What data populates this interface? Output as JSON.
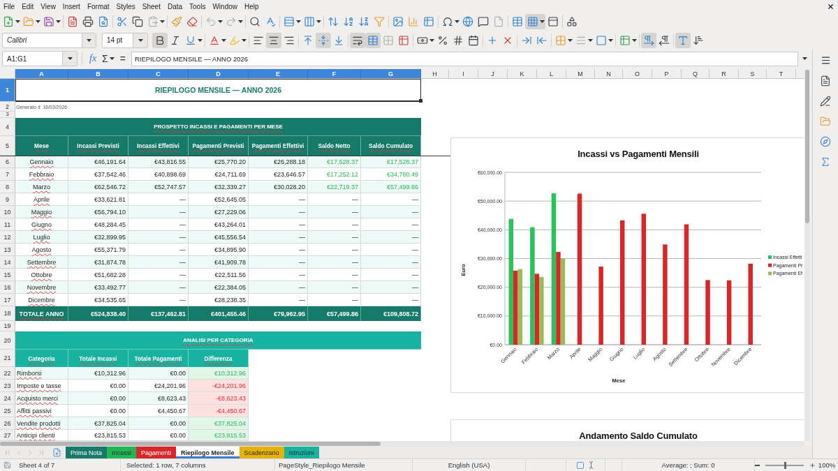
{
  "menu": [
    "File",
    "Edit",
    "View",
    "Insert",
    "Format",
    "Styles",
    "Sheet",
    "Data",
    "Tools",
    "Window",
    "Help"
  ],
  "standard_toolbar": [
    {
      "buttons": [
        {
          "kind": "new",
          "pressed": false,
          "disabled": false
        },
        {
          "kind": "open",
          "pressed": false,
          "disabled": false
        },
        {
          "kind": "save",
          "pressed": false,
          "disabled": false
        }
      ]
    },
    {
      "buttons": [
        {
          "kind": "pdf",
          "pressed": false,
          "disabled": false
        },
        {
          "kind": "print",
          "pressed": false,
          "disabled": false
        },
        {
          "kind": "preview",
          "pressed": false,
          "disabled": false
        }
      ]
    },
    {
      "buttons": [
        {
          "kind": "cut",
          "pressed": false,
          "disabled": false
        },
        {
          "kind": "copy",
          "pressed": false,
          "disabled": false
        },
        {
          "kind": "paste",
          "pressed": false,
          "disabled": true
        }
      ]
    },
    {
      "buttons": [
        {
          "kind": "clone",
          "pressed": false,
          "disabled": false
        },
        {
          "kind": "clear",
          "pressed": false,
          "disabled": false
        }
      ]
    },
    {
      "buttons": [
        {
          "kind": "undo",
          "pressed": false,
          "disabled": true
        },
        {
          "kind": "redo",
          "pressed": false,
          "disabled": true
        }
      ]
    },
    {
      "buttons": [
        {
          "kind": "find",
          "pressed": false,
          "disabled": false
        },
        {
          "kind": "spelling",
          "pressed": false,
          "disabled": false
        }
      ]
    },
    {
      "buttons": [
        {
          "kind": "rows",
          "pressed": false,
          "disabled": false
        },
        {
          "kind": "columns",
          "pressed": false,
          "disabled": false
        }
      ]
    },
    {
      "buttons": [
        {
          "kind": "sort",
          "pressed": false,
          "disabled": false
        },
        {
          "kind": "sortasc",
          "pressed": false,
          "disabled": false
        },
        {
          "kind": "sortdesc",
          "pressed": false,
          "disabled": false
        },
        {
          "kind": "autofilter",
          "pressed": false,
          "disabled": false
        }
      ]
    },
    {
      "buttons": [
        {
          "kind": "image",
          "pressed": false,
          "disabled": false
        },
        {
          "kind": "chart",
          "pressed": false,
          "disabled": false
        },
        {
          "kind": "pivot",
          "pressed": false,
          "disabled": false
        }
      ]
    },
    {
      "buttons": [
        {
          "kind": "special",
          "pressed": false,
          "disabled": false
        },
        {
          "kind": "hyperlink",
          "pressed": false,
          "disabled": false
        },
        {
          "kind": "comment",
          "pressed": false,
          "disabled": false
        },
        {
          "kind": "headerfooter",
          "pressed": false,
          "disabled": true
        }
      ]
    },
    {
      "buttons": [
        {
          "kind": "printarea",
          "pressed": false,
          "disabled": false
        },
        {
          "kind": "freeze",
          "pressed": true,
          "disabled": false
        },
        {
          "kind": "split",
          "pressed": false,
          "disabled": false
        }
      ]
    },
    {
      "buttons": [
        {
          "kind": "draw",
          "pressed": false,
          "disabled": false
        }
      ]
    }
  ],
  "formatting_toolbar": {
    "font_name": "Calibri",
    "font_size": "14 pt",
    "groups": [
      {
        "buttons": [
          {
            "kind": "bold",
            "pressed": true,
            "disabled": false
          },
          {
            "kind": "italic",
            "pressed": false,
            "disabled": false
          },
          {
            "kind": "underline",
            "pressed": false,
            "disabled": false
          }
        ]
      },
      {
        "buttons": [
          {
            "kind": "fontcolor",
            "pressed": false,
            "disabled": false
          },
          {
            "kind": "highlight",
            "pressed": false,
            "disabled": false
          }
        ]
      },
      {
        "buttons": [
          {
            "kind": "left",
            "pressed": false,
            "disabled": false
          },
          {
            "kind": "center",
            "pressed": true,
            "disabled": false
          },
          {
            "kind": "right",
            "pressed": false,
            "disabled": false
          }
        ]
      },
      {
        "buttons": [
          {
            "kind": "top",
            "pressed": false,
            "disabled": false
          },
          {
            "kind": "middle",
            "pressed": true,
            "disabled": false
          },
          {
            "kind": "bottom",
            "pressed": false,
            "disabled": false
          }
        ]
      },
      {
        "buttons": [
          {
            "kind": "wrap",
            "pressed": true,
            "disabled": false
          },
          {
            "kind": "mergecenter",
            "pressed": true,
            "disabled": false
          },
          {
            "kind": "merge",
            "pressed": false,
            "disabled": true
          },
          {
            "kind": "unmerge",
            "pressed": false,
            "disabled": false
          }
        ]
      },
      {
        "buttons": [
          {
            "kind": "currency",
            "pressed": false,
            "disabled": false
          },
          {
            "kind": "percent",
            "pressed": false,
            "disabled": false
          },
          {
            "kind": "number",
            "pressed": false,
            "disabled": false
          },
          {
            "kind": "date",
            "pressed": false,
            "disabled": false
          }
        ]
      },
      {
        "buttons": [
          {
            "kind": "adddecimal",
            "pressed": false,
            "disabled": false
          },
          {
            "kind": "deldecimal",
            "pressed": false,
            "disabled": false
          }
        ]
      },
      {
        "buttons": [
          {
            "kind": "indent",
            "pressed": false,
            "disabled": false
          },
          {
            "kind": "outdent",
            "pressed": false,
            "disabled": false
          }
        ]
      },
      {
        "buttons": [
          {
            "kind": "borders",
            "pressed": false,
            "disabled": false
          },
          {
            "kind": "borderstyle",
            "pressed": false,
            "disabled": true
          },
          {
            "kind": "bordercolor",
            "pressed": false,
            "disabled": false
          }
        ]
      },
      {
        "buttons": [
          {
            "kind": "conditional",
            "pressed": false,
            "disabled": false
          }
        ]
      },
      {
        "buttons": [
          {
            "kind": "ltr",
            "pressed": true,
            "disabled": false
          },
          {
            "kind": "rtl",
            "pressed": false,
            "disabled": false
          }
        ]
      },
      {
        "buttons": [
          {
            "kind": "textflow",
            "pressed": true,
            "disabled": false
          },
          {
            "kind": "vertical",
            "pressed": false,
            "disabled": false
          }
        ]
      }
    ]
  },
  "formula_bar": {
    "name_box": "A1:G1",
    "buttons": [
      {
        "kind": "function",
        "label": "fx"
      },
      {
        "kind": "sum",
        "label": "Σ"
      },
      {
        "kind": "formula",
        "label": "="
      }
    ],
    "content": "RIEPILOGO MENSILE — ANNO 2026"
  },
  "sheet": {
    "column_headers": [
      {
        "label": "A",
        "selected": true
      },
      {
        "label": "B",
        "selected": true
      },
      {
        "label": "C",
        "selected": true
      },
      {
        "label": "D",
        "selected": true
      },
      {
        "label": "E",
        "selected": true
      },
      {
        "label": "F",
        "selected": true
      },
      {
        "label": "G",
        "selected": true
      },
      {
        "label": "H",
        "selected": false
      },
      {
        "label": "I",
        "selected": false
      },
      {
        "label": "J",
        "selected": false
      },
      {
        "label": "K",
        "selected": false
      },
      {
        "label": "L",
        "selected": false
      },
      {
        "label": "M",
        "selected": false
      },
      {
        "label": "N",
        "selected": false
      },
      {
        "label": "O",
        "selected": false
      },
      {
        "label": "P",
        "selected": false
      },
      {
        "label": "Q",
        "selected": false
      },
      {
        "label": "R",
        "selected": false
      },
      {
        "label": "S",
        "selected": false
      },
      {
        "label": "T",
        "selected": false
      }
    ],
    "row_headers": [
      {
        "label": "1",
        "selected": true
      },
      {
        "label": "2",
        "selected": false
      },
      {
        "label": "3",
        "selected": false
      },
      {
        "label": "4",
        "selected": false
      },
      {
        "label": "5",
        "selected": false
      },
      {
        "label": "6",
        "selected": false
      },
      {
        "label": "7",
        "selected": false
      },
      {
        "label": "8",
        "selected": false
      },
      {
        "label": "9",
        "selected": false
      },
      {
        "label": "10",
        "selected": false
      },
      {
        "label": "11",
        "selected": false
      },
      {
        "label": "12",
        "selected": false
      },
      {
        "label": "13",
        "selected": false
      },
      {
        "label": "14",
        "selected": false
      },
      {
        "label": "15",
        "selected": false
      },
      {
        "label": "16",
        "selected": false
      },
      {
        "label": "17",
        "selected": false
      },
      {
        "label": "18",
        "selected": false
      },
      {
        "label": "19",
        "selected": false
      },
      {
        "label": "20",
        "selected": false
      },
      {
        "label": "21",
        "selected": false
      },
      {
        "label": "22",
        "selected": false
      },
      {
        "label": "23",
        "selected": false
      },
      {
        "label": "24",
        "selected": false
      },
      {
        "label": "25",
        "selected": false
      },
      {
        "label": "26",
        "selected": false
      },
      {
        "label": "27",
        "selected": false
      }
    ],
    "title": {
      "text": "RIEPILOGO MENSILE — ANNO 2026",
      "selected": true
    },
    "generated": "Generato il: 16/03/2026",
    "monthly_table": {
      "caption": "PROSPETTO INCASSI E PAGAMENTI PER MESE",
      "columns": [
        "Mese",
        "Incassi Previsti",
        "Incassi Effettivi",
        "Pagamenti Previsti",
        "Pagamenti Effettivi",
        "Saldo Netto",
        "Saldo Cumulato"
      ],
      "rows": [
        {
          "kind": "actual",
          "cells": [
            "Gennaio",
            "€46,191.64",
            "€43,816.55",
            "€25,770.20",
            "€26,288.18",
            "€17,528.37",
            "€17,528.37"
          ]
        },
        {
          "kind": "actual",
          "cells": [
            "Febbraio",
            "€37,542.46",
            "€40,898.69",
            "€24,711.69",
            "€23,646.57",
            "€17,252.12",
            "€34,780.49"
          ]
        },
        {
          "kind": "actual",
          "cells": [
            "Marzo",
            "€62,546.72",
            "€52,747.57",
            "€32,339.27",
            "€30,028.20",
            "€22,719.37",
            "€57,499.86"
          ]
        },
        {
          "kind": "forecast",
          "cells": [
            "Aprile",
            "€33,621.81",
            "—",
            "€52,645.05",
            "—",
            "—",
            "—"
          ]
        },
        {
          "kind": "forecast",
          "cells": [
            "Maggio",
            "€56,794.10",
            "—",
            "€27,229.06",
            "—",
            "—",
            "—"
          ]
        },
        {
          "kind": "forecast",
          "cells": [
            "Giugno",
            "€48,284.45",
            "—",
            "€43,264.01",
            "—",
            "—",
            "—"
          ]
        },
        {
          "kind": "forecast",
          "cells": [
            "Luglio",
            "€32,899.95",
            "—",
            "€45,556.54",
            "—",
            "—",
            "—"
          ]
        },
        {
          "kind": "forecast",
          "cells": [
            "Agosto",
            "€55,371.79",
            "—",
            "€34,895.90",
            "—",
            "—",
            "—"
          ]
        },
        {
          "kind": "forecast",
          "cells": [
            "Settembre",
            "€31,874.78",
            "—",
            "€41,909.78",
            "—",
            "—",
            "—"
          ]
        },
        {
          "kind": "forecast",
          "cells": [
            "Ottobre",
            "€51,682.28",
            "—",
            "€22,511.56",
            "—",
            "—",
            "—"
          ]
        },
        {
          "kind": "forecast",
          "cells": [
            "Novembre",
            "€33,492.77",
            "—",
            "€22,384.05",
            "—",
            "—",
            "—"
          ]
        },
        {
          "kind": "forecast",
          "cells": [
            "Dicembre",
            "€34,535.65",
            "—",
            "€28,238.35",
            "—",
            "—",
            "—"
          ]
        }
      ],
      "total": [
        "TOTALE ANNO",
        "€524,838.40",
        "€137,462.81",
        "€401,455.46",
        "€79,962.95",
        "€57,499.86",
        "€109,808.72"
      ]
    },
    "category_table": {
      "caption": "ANALISI PER CATEGORIA",
      "columns": [
        "Categoria",
        "Totale Incassi",
        "Totale Pagamenti",
        "Differenza"
      ],
      "rows": [
        {
          "kind": "positive",
          "cells": [
            "Rimborsi",
            "€10,312.96",
            "€0.00",
            "€10,312.96"
          ]
        },
        {
          "kind": "negative",
          "cells": [
            "Imposte e tasse",
            "€0.00",
            "€24,201.96",
            "-€24,201.96"
          ]
        },
        {
          "kind": "negative",
          "cells": [
            "Acquisto merci",
            "€0.00",
            "€8,623.43",
            "-€8,623.43"
          ]
        },
        {
          "kind": "negative",
          "cells": [
            "Affitti passivi",
            "€0.00",
            "€4,450.67",
            "-€4,450.67"
          ]
        },
        {
          "kind": "positive",
          "cells": [
            "Vendite prodotti",
            "€37,825.04",
            "€0.00",
            "€37,825.04"
          ]
        },
        {
          "kind": "positive",
          "cells": [
            "Anticipi clienti",
            "€23,815.53",
            "€0.00",
            "€23,815.53"
          ]
        }
      ]
    },
    "charts": [
      {
        "chart_data": {
          "type": "bar",
          "title": "Incassi vs Pagamenti Mensili",
          "xlabel": "Mese",
          "ylabel": "Euro",
          "categories": [
            "Gennaio",
            "Febbraio",
            "Marzo",
            "Aprile",
            "Maggio",
            "Giugno",
            "Luglio",
            "Agosto",
            "Settembre",
            "Ottobre",
            "Novembre",
            "Dicembre"
          ],
          "series": [
            {
              "name": "Incassi Effetti",
              "color": "#2cc25b",
              "values": [
                43800,
                40900,
                52700,
                null,
                null,
                null,
                null,
                null,
                null,
                null,
                null,
                null
              ]
            },
            {
              "name": "Pagamenti Pr",
              "color": "#d62828",
              "values": [
                25800,
                24700,
                32300,
                52600,
                27200,
                43300,
                45600,
                34900,
                41900,
                22500,
                22400,
                28200
              ]
            },
            {
              "name": "Pagamenti Ef",
              "color": "#9bbb59",
              "values": [
                26300,
                23600,
                30000,
                null,
                null,
                null,
                null,
                null,
                null,
                null,
                null,
                null
              ]
            }
          ],
          "ylim": [
            0,
            60000
          ],
          "yticks": [
            {
              "value": 0,
              "label": "€0.00"
            },
            {
              "value": 10000,
              "label": "€10,000.00"
            },
            {
              "value": 20000,
              "label": "€20,000.00"
            },
            {
              "value": 30000,
              "label": "€30,000.00"
            },
            {
              "value": 40000,
              "label": "€40,000.00"
            },
            {
              "value": 50000,
              "label": "€50,000.00"
            },
            {
              "value": 60000,
              "label": "€60,000.00"
            }
          ],
          "grid": true,
          "legend": "right"
        }
      },
      {
        "title": "Andamento Saldo Cumulato"
      }
    ]
  },
  "sheet_navigation": [
    {
      "kind": "first",
      "disabled": true
    },
    {
      "kind": "previous",
      "disabled": true
    },
    {
      "kind": "next",
      "disabled": true
    },
    {
      "kind": "last",
      "disabled": true
    }
  ],
  "sheet_tabs": [
    {
      "label": "Prima Nota",
      "selected": false,
      "color": "#177a6b"
    },
    {
      "label": "Incassi",
      "selected": false,
      "color": "#22b455"
    },
    {
      "label": "Pagamenti",
      "selected": false,
      "color": "#d9262b"
    },
    {
      "label": "Riepilogo Mensile",
      "selected": true,
      "color": "#3a7fd5"
    },
    {
      "label": "Scadenzario",
      "selected": false,
      "color": "#e8b00a"
    },
    {
      "label": "Istruzioni",
      "selected": false,
      "color": "#1ab3a0"
    }
  ],
  "sidebar": [
    {
      "kind": "properties",
      "selected": false
    },
    {
      "kind": "styles",
      "selected": false
    },
    {
      "kind": "gallery",
      "selected": false
    },
    {
      "kind": "navigator",
      "selected": false
    },
    {
      "kind": "functions",
      "selected": false
    }
  ],
  "status_bar": {
    "sheet": "Sheet 4 of 7",
    "selection": "Selected: 1 row, 7 columns",
    "page_style": "PageStyle_Riepilogo Mensile",
    "language": "English (USA)",
    "summary": "Average: ; Sum: 0",
    "zoom": {
      "level": 0.5,
      "label": "100%"
    }
  }
}
